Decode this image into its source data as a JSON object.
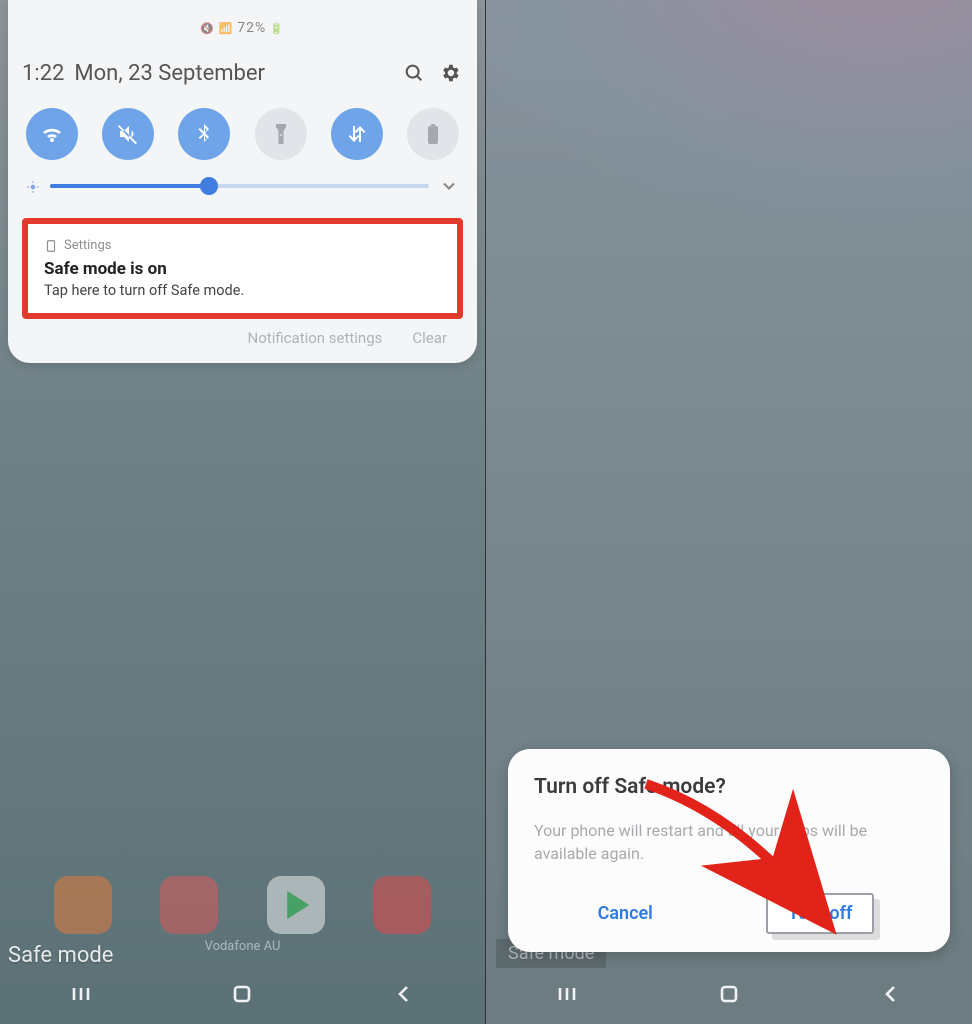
{
  "left": {
    "status_text": "72%",
    "time": "1:22",
    "date": "Mon, 23 September",
    "quick_settings": {
      "wifi": "wifi-icon",
      "mute": "mute-icon",
      "bluetooth": "bluetooth-icon",
      "flashlight": "flashlight-icon",
      "data": "data-arrows-icon",
      "battery": "battery-icon"
    },
    "brightness_percent": 42,
    "notification": {
      "source": "Settings",
      "title": "Safe mode is on",
      "body": "Tap here to turn off Safe mode."
    },
    "footer": {
      "settings": "Notification settings",
      "clear": "Clear"
    },
    "dock_label": "Vodafone AU",
    "safe_mode_badge": "Safe mode"
  },
  "right": {
    "dialog": {
      "title": "Turn off Safe mode?",
      "body": "Your phone will restart and all your apps will be available again.",
      "cancel": "Cancel",
      "confirm": "Turn off"
    },
    "safe_mode_badge": "Safe mode"
  }
}
